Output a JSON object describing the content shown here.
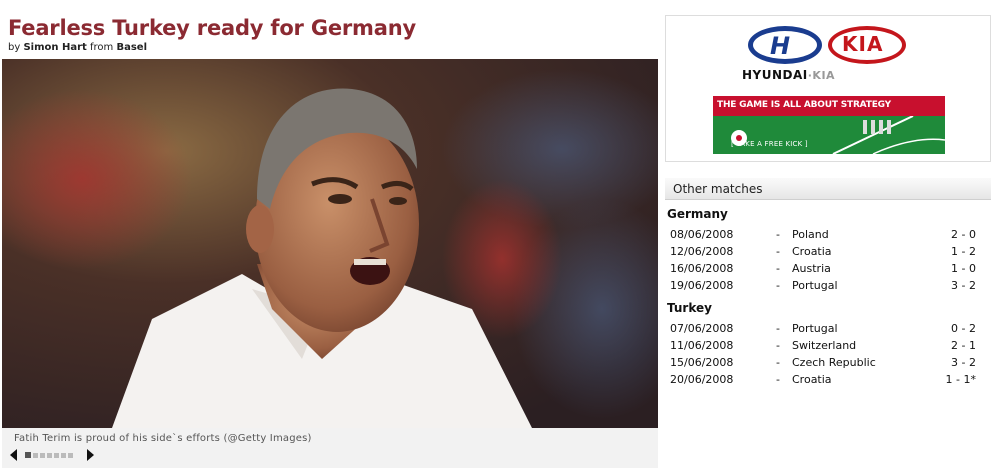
{
  "article": {
    "headline": "Fearless Turkey ready for Germany",
    "by": "by",
    "author": "Simon Hart",
    "from": "from",
    "location": "Basel",
    "caption": "Fatih Terim is proud of his side`s efforts (@Getty Images)"
  },
  "gallery": {
    "dots": 7,
    "active_dot": 1
  },
  "ad": {
    "brand1": "HYUNDAI",
    "brand2": "KIA",
    "brand_line_sep": "·",
    "banner_text": "THE GAME IS ALL ABOUT STRATEGY",
    "banner_cta": "[ TAKE A FREE KICK ]",
    "colors": {
      "hyundai": "#1a3c8f",
      "kia": "#c4161c",
      "banner_red": "#c8102e",
      "banner_green": "#1f8a3a"
    }
  },
  "sidebar": {
    "title": "Other matches",
    "groups": [
      {
        "team": "Germany",
        "matches": [
          {
            "date": "08/06/2008",
            "sep": "-",
            "opponent": "Poland",
            "score": "2 - 0"
          },
          {
            "date": "12/06/2008",
            "sep": "-",
            "opponent": "Croatia",
            "score": "1 - 2"
          },
          {
            "date": "16/06/2008",
            "sep": "-",
            "opponent": "Austria",
            "score": "1 - 0"
          },
          {
            "date": "19/06/2008",
            "sep": "-",
            "opponent": "Portugal",
            "score": "3 - 2"
          }
        ]
      },
      {
        "team": "Turkey",
        "matches": [
          {
            "date": "07/06/2008",
            "sep": "-",
            "opponent": "Portugal",
            "score": "0 - 2"
          },
          {
            "date": "11/06/2008",
            "sep": "-",
            "opponent": "Switzerland",
            "score": "2 - 1"
          },
          {
            "date": "15/06/2008",
            "sep": "-",
            "opponent": "Czech Republic",
            "score": "3 - 2"
          },
          {
            "date": "20/06/2008",
            "sep": "-",
            "opponent": "Croatia",
            "score": "1 - 1*"
          }
        ]
      }
    ]
  },
  "colors": {
    "headline": "#8b2a32"
  }
}
